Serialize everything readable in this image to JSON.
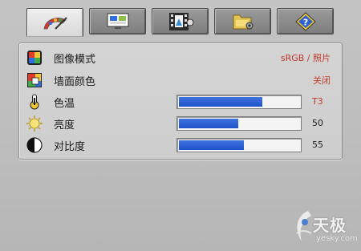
{
  "tabs": [
    {
      "icon": "picture-palette-icon",
      "active": true
    },
    {
      "icon": "monitor-display-icon",
      "active": false
    },
    {
      "icon": "film-media-icon",
      "active": false
    },
    {
      "icon": "folder-settings-icon",
      "active": false
    },
    {
      "icon": "question-help-icon",
      "active": false
    }
  ],
  "settings": {
    "image_mode": {
      "label": "图像模式",
      "value": "sRGB / 照片",
      "icon": "color-squares-icon"
    },
    "wall_color": {
      "label": "墙面颜色",
      "value": "关闭",
      "icon": "wall-color-icon"
    },
    "color_temp": {
      "label": "色温",
      "value": "T3",
      "level": 0.7,
      "icon": "thermometer-icon"
    },
    "brightness": {
      "label": "亮度",
      "value": "50",
      "level": 0.5,
      "icon": "sun-icon"
    },
    "contrast": {
      "label": "对比度",
      "value": "55",
      "level": 0.55,
      "icon": "contrast-circle-icon"
    }
  },
  "logo": {
    "cn": "天极",
    "domain": "yesky.com"
  },
  "colors": {
    "accent": "#2a5ed6",
    "value_red": "#c0392b"
  }
}
